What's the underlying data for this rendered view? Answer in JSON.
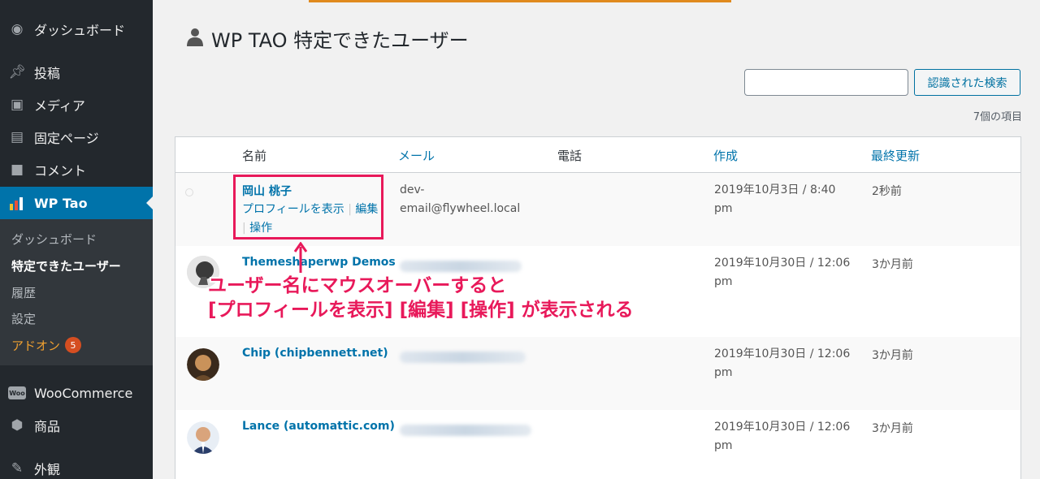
{
  "sidebar": {
    "items": [
      {
        "label": "ダッシュボード",
        "icon": "dashboard-icon"
      },
      {
        "label": "投稿",
        "icon": "pin-icon"
      },
      {
        "label": "メディア",
        "icon": "media-icon"
      },
      {
        "label": "固定ページ",
        "icon": "page-icon"
      },
      {
        "label": "コメント",
        "icon": "comment-icon"
      },
      {
        "label": "WP Tao",
        "icon": "chart-icon"
      },
      {
        "label": "WooCommerce",
        "icon": "woo-icon"
      },
      {
        "label": "商品",
        "icon": "box-icon"
      },
      {
        "label": "外観",
        "icon": "brush-icon"
      }
    ],
    "woo_badge": "Woo",
    "submenu": [
      {
        "label": "ダッシュボード"
      },
      {
        "label": "特定できたユーザー"
      },
      {
        "label": "履歴"
      },
      {
        "label": "設定"
      },
      {
        "label": "アドオン",
        "badge": "5"
      }
    ]
  },
  "page": {
    "title": "WP TAO 特定できたユーザー",
    "search_placeholder": "",
    "search_button": "認識された検索",
    "item_count": "7個の項目"
  },
  "table": {
    "headers": {
      "name": "名前",
      "email": "メール",
      "phone": "電話",
      "created": "作成",
      "updated": "最終更新"
    },
    "rows": [
      {
        "name": "岡山 桃子",
        "actions": [
          "プロフィールを表示",
          "編集",
          "操作"
        ],
        "email": "dev-email@flywheel.local",
        "email_line1": "dev-",
        "email_line2": "email@flywheel.local",
        "created_line1": "2019年10月3日 / 8:40",
        "created_line2": "pm",
        "updated": "2秒前"
      },
      {
        "name": "Themeshaperwp Demos",
        "email": "",
        "created_line1": "2019年10月30日 / 12:06",
        "created_line2": "pm",
        "updated": "3か月前"
      },
      {
        "name": "Chip (chipbennett.net)",
        "email": "",
        "created_line1": "2019年10月30日 / 12:06",
        "created_line2": "pm",
        "updated": "3か月前"
      },
      {
        "name": "Lance (automattic.com)",
        "email": "",
        "created_line1": "2019年10月30日 / 12:06",
        "created_line2": "pm",
        "updated": "3か月前"
      }
    ]
  },
  "annotation": {
    "line1": "ユーザー名にマウスオーバーすると",
    "line2": "[プロフィールを表示] [編集] [操作] が表示される",
    "color": "#e8195a"
  },
  "colors": {
    "sidebar": "#23282d",
    "accent": "#0073aa",
    "annotation": "#e8195a"
  }
}
